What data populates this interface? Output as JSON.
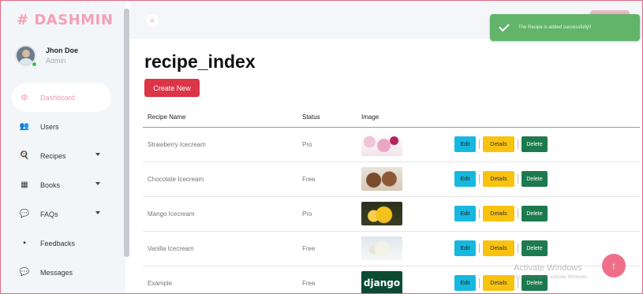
{
  "app": {
    "logo": "# DASHMIN"
  },
  "profile": {
    "name": "Jhon Doe",
    "role": "Admin"
  },
  "sidebar": {
    "items": [
      {
        "label": "Dashboard",
        "icon": "dashboard-icon",
        "glyph": "◍",
        "active": true,
        "dropdown": false
      },
      {
        "label": "Users",
        "icon": "users-icon",
        "glyph": "👥",
        "active": false,
        "dropdown": false
      },
      {
        "label": "Recipes",
        "icon": "recipes-icon",
        "glyph": "🍳",
        "active": false,
        "dropdown": true
      },
      {
        "label": "Books",
        "icon": "books-icon",
        "glyph": "▦",
        "active": false,
        "dropdown": true
      },
      {
        "label": "FAQs",
        "icon": "faqs-icon",
        "glyph": "💬",
        "active": false,
        "dropdown": true
      },
      {
        "label": "Feedbacks",
        "icon": "feedbacks-icon",
        "glyph": "▪",
        "active": false,
        "dropdown": false
      },
      {
        "label": "Messages",
        "icon": "messages-icon",
        "glyph": "💬",
        "active": false,
        "dropdown": false
      }
    ]
  },
  "toast": {
    "message": "The Recipe is added successfully!!"
  },
  "page": {
    "title": "recipe_index",
    "create_label": "Create New"
  },
  "table": {
    "headers": {
      "name": "Recipe Name",
      "status": "Status",
      "image": "Image"
    },
    "action_labels": {
      "edit": "Edit",
      "details": "Details",
      "delete": "Delete"
    },
    "rows": [
      {
        "name": "Strawberry Icecream",
        "status": "Pro",
        "image": "strawberry"
      },
      {
        "name": "Chocolate Icecream",
        "status": "Free",
        "image": "chocolate"
      },
      {
        "name": "Mango Icecream",
        "status": "Pro",
        "image": "mango"
      },
      {
        "name": "Vanilla Icecream",
        "status": "Free",
        "image": "vanilla"
      },
      {
        "name": "Example",
        "status": "Free",
        "image": "django",
        "image_text": "django"
      }
    ]
  },
  "watermark": {
    "title": "Activate Windows",
    "subtitle": "Go to Settings to activate Windows."
  },
  "colors": {
    "accent": "#f5a0b5",
    "danger": "#dc3545",
    "toast": "#62b46a"
  }
}
